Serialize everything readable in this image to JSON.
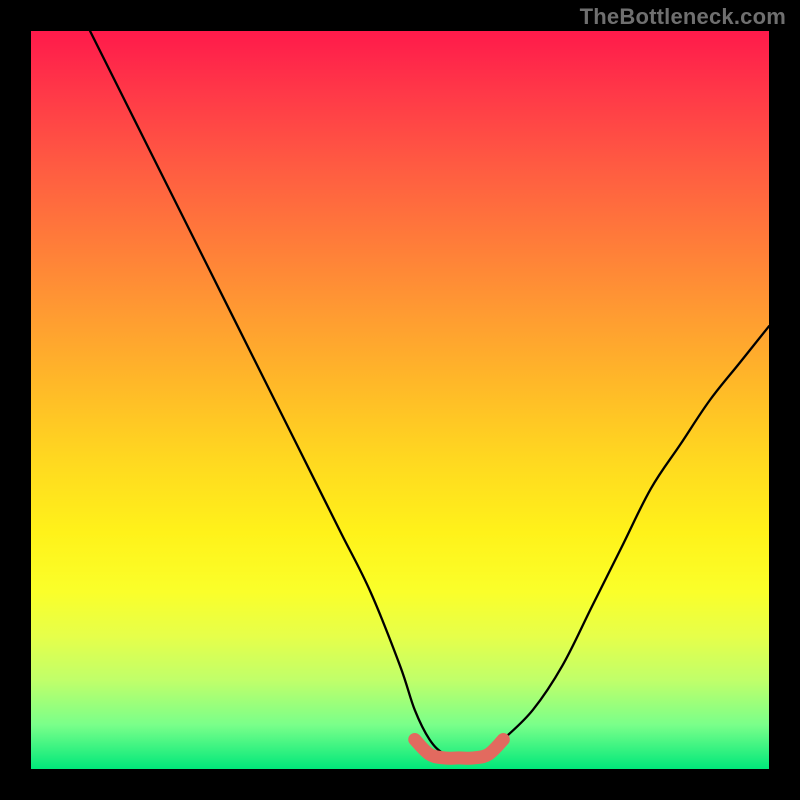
{
  "watermark": "TheBottleneck.com",
  "chart_data": {
    "type": "line",
    "title": "",
    "xlabel": "",
    "ylabel": "",
    "xlim": [
      0,
      100
    ],
    "ylim": [
      0,
      100
    ],
    "grid": false,
    "legend": false,
    "series": [
      {
        "name": "bottleneck-curve",
        "color": "#000000",
        "x": [
          8,
          10,
          14,
          18,
          22,
          26,
          30,
          34,
          38,
          42,
          46,
          50,
          52,
          54,
          56,
          58,
          60,
          62,
          64,
          68,
          72,
          76,
          80,
          84,
          88,
          92,
          96,
          100
        ],
        "y": [
          100,
          96,
          88,
          80,
          72,
          64,
          56,
          48,
          40,
          32,
          24,
          14,
          8,
          4,
          2,
          1.5,
          1.5,
          2,
          4,
          8,
          14,
          22,
          30,
          38,
          44,
          50,
          55,
          60
        ]
      },
      {
        "name": "highlight-band",
        "color": "#e26a5f",
        "x": [
          52,
          54,
          56,
          58,
          60,
          62,
          64
        ],
        "y": [
          4,
          2,
          1.5,
          1.5,
          1.5,
          2,
          4
        ]
      }
    ],
    "gradient_stops": [
      {
        "pos": 0,
        "color": "#ff1a4b"
      },
      {
        "pos": 8,
        "color": "#ff3748"
      },
      {
        "pos": 18,
        "color": "#ff5a42"
      },
      {
        "pos": 28,
        "color": "#ff7a3a"
      },
      {
        "pos": 38,
        "color": "#ff9a32"
      },
      {
        "pos": 48,
        "color": "#ffb928"
      },
      {
        "pos": 58,
        "color": "#ffd820"
      },
      {
        "pos": 68,
        "color": "#fff21a"
      },
      {
        "pos": 76,
        "color": "#faff2a"
      },
      {
        "pos": 82,
        "color": "#e6ff4a"
      },
      {
        "pos": 88,
        "color": "#c0ff6a"
      },
      {
        "pos": 94,
        "color": "#7aff8a"
      },
      {
        "pos": 100,
        "color": "#00e87a"
      }
    ]
  }
}
